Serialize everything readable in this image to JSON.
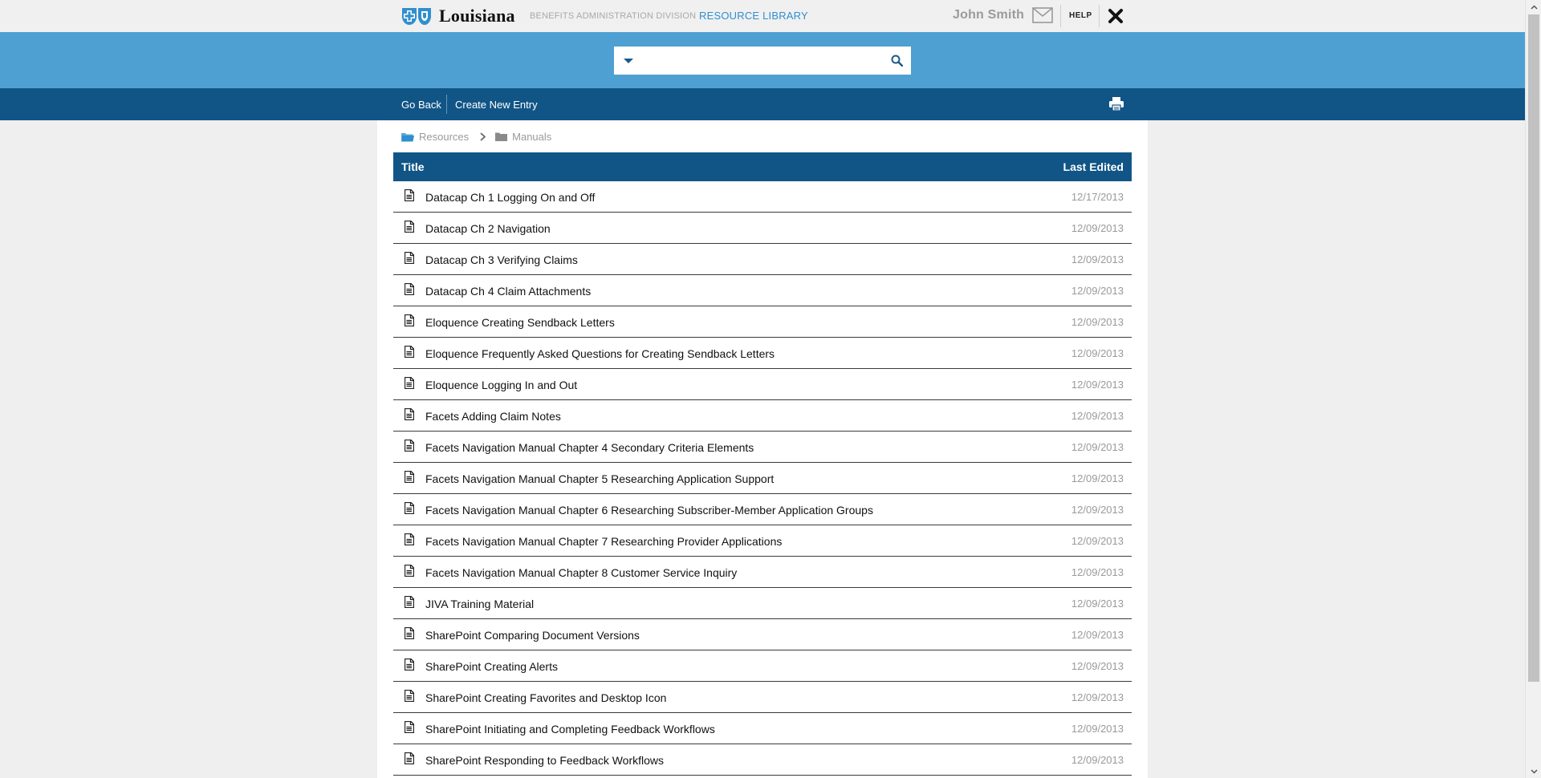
{
  "header": {
    "logo_text": "Louisiana",
    "division": "BENEFITS ADMINISTRATION DIVISION",
    "resource_library": "RESOURCE LIBRARY",
    "user_name": "John Smith",
    "help": "HELP",
    "icons": [
      "cross-shield-logo-icon",
      "mail-icon",
      "close-icon"
    ]
  },
  "search": {
    "value": "",
    "placeholder": ""
  },
  "actions": {
    "go_back": "Go Back",
    "create_new_entry": "Create New Entry"
  },
  "breadcrumb": {
    "root": "Resources",
    "current": "Manuals"
  },
  "table": {
    "col_title": "Title",
    "col_last_edited": "Last Edited",
    "rows": [
      {
        "title": "Datacap Ch 1 Logging On and Off",
        "date": "12/17/2013"
      },
      {
        "title": "Datacap Ch 2 Navigation",
        "date": "12/09/2013"
      },
      {
        "title": "Datacap Ch 3 Verifying Claims",
        "date": "12/09/2013"
      },
      {
        "title": "Datacap Ch 4 Claim Attachments",
        "date": "12/09/2013"
      },
      {
        "title": "Eloquence Creating Sendback Letters",
        "date": "12/09/2013"
      },
      {
        "title": "Eloquence Frequently Asked Questions for Creating Sendback Letters",
        "date": "12/09/2013"
      },
      {
        "title": "Eloquence Logging In and Out",
        "date": "12/09/2013"
      },
      {
        "title": "Facets Adding Claim Notes",
        "date": "12/09/2013"
      },
      {
        "title": "Facets Navigation Manual Chapter 4 Secondary Criteria Elements",
        "date": "12/09/2013"
      },
      {
        "title": "Facets Navigation Manual Chapter 5 Researching Application Support",
        "date": "12/09/2013"
      },
      {
        "title": "Facets Navigation Manual Chapter 6 Researching Subscriber-Member Application Groups",
        "date": "12/09/2013"
      },
      {
        "title": "Facets Navigation Manual Chapter 7 Researching Provider Applications",
        "date": "12/09/2013"
      },
      {
        "title": "Facets Navigation Manual Chapter 8 Customer Service Inquiry",
        "date": "12/09/2013"
      },
      {
        "title": "JIVA Training Material",
        "date": "12/09/2013"
      },
      {
        "title": "SharePoint Comparing Document Versions",
        "date": "12/09/2013"
      },
      {
        "title": "SharePoint Creating Alerts",
        "date": "12/09/2013"
      },
      {
        "title": "SharePoint Creating Favorites and Desktop Icon",
        "date": "12/09/2013"
      },
      {
        "title": "SharePoint Initiating and Completing Feedback Workflows",
        "date": "12/09/2013"
      },
      {
        "title": "SharePoint Responding to Feedback Workflows",
        "date": "12/09/2013"
      }
    ]
  },
  "colors": {
    "top_bar_bg": "#f0f0f0",
    "search_band_bg": "#4fa0d2",
    "action_bar_bg": "#115587",
    "table_header_bg": "#115587",
    "accent_link": "#2f8fcf",
    "page_bg": "#efefef"
  }
}
